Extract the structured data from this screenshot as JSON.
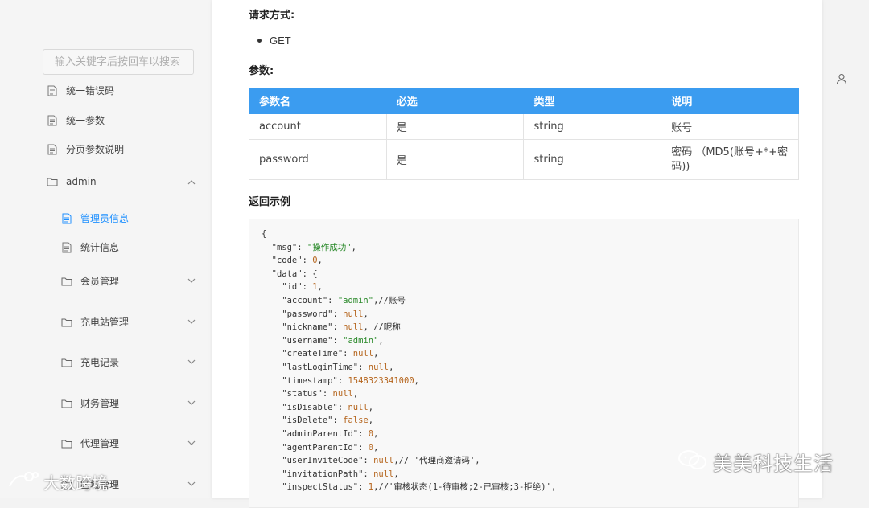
{
  "search": {
    "placeholder": "输入关键字后按回车以搜索"
  },
  "sidebar": {
    "items": [
      {
        "label": "统一错误码",
        "icon": "doc-icon"
      },
      {
        "label": "统一参数",
        "icon": "doc-icon"
      },
      {
        "label": "分页参数说明",
        "icon": "doc-icon"
      },
      {
        "label": "admin",
        "icon": "folder-icon"
      },
      {
        "label": "管理员信息",
        "icon": "doc-icon"
      },
      {
        "label": "统计信息",
        "icon": "doc-icon"
      },
      {
        "label": "会员管理",
        "icon": "folder-icon"
      },
      {
        "label": "充电站管理",
        "icon": "folder-icon"
      },
      {
        "label": "充电记录",
        "icon": "folder-icon"
      },
      {
        "label": "财务管理",
        "icon": "folder-icon"
      },
      {
        "label": "代理管理",
        "icon": "folder-icon"
      },
      {
        "label": "区域管理",
        "icon": "folder-icon"
      }
    ],
    "active_color": "#1e90ff"
  },
  "main": {
    "request_method_heading": "请求方式:",
    "request_method_value": "GET",
    "params_heading": "参数:",
    "table": {
      "headers": [
        "参数名",
        "必选",
        "类型",
        "说明"
      ],
      "rows": [
        [
          "account",
          "是",
          "string",
          "账号"
        ],
        [
          "password",
          "是",
          "string",
          "密码 （MD5(账号+*+密码))"
        ]
      ],
      "header_color": "#3b9cf0"
    },
    "return_heading": "返回示例",
    "code": {
      "open": "{",
      "l1k": "  \"msg\": ",
      "l1v": "\"操作成功\"",
      "l1e": ",",
      "l2k": "  \"code\": ",
      "l2v": "0",
      "l2e": ",",
      "l3": "  \"data\": {",
      "l4k": "    \"id\": ",
      "l4v": "1",
      "l4e": ",",
      "l5k": "    \"account\": ",
      "l5v": "\"admin\"",
      "l5e": ",//账号",
      "l6k": "    \"password\": ",
      "l6v": "null",
      "l6e": ",",
      "l7k": "    \"nickname\": ",
      "l7v": "null",
      "l7e": ", //昵称",
      "l8k": "    \"username\": ",
      "l8v": "\"admin\"",
      "l8e": ",",
      "l9k": "    \"createTime\": ",
      "l9v": "null",
      "l9e": ",",
      "l10k": "    \"lastLoginTime\": ",
      "l10v": "null",
      "l10e": ",",
      "l11k": "    \"timestamp\": ",
      "l11v": "1548323341000",
      "l11e": ",",
      "l12k": "    \"status\": ",
      "l12v": "null",
      "l12e": ",",
      "l13k": "    \"isDisable\": ",
      "l13v": "null",
      "l13e": ",",
      "l14k": "    \"isDelete\": ",
      "l14v": "false",
      "l14e": ",",
      "l15k": "    \"adminParentId\": ",
      "l15v": "0",
      "l15e": ",",
      "l16k": "    \"agentParentId\": ",
      "l16v": "0",
      "l16e": ",",
      "l17k": "    \"userInviteCode\": ",
      "l17v": "null",
      "l17e": ",// '代理商邀请码',",
      "l18k": "    \"invitationPath\": ",
      "l18v": "null",
      "l18e": ",",
      "l19k": "    \"inspectStatus\": ",
      "l19v": "1",
      "l19e": ",//'审核状态(1-待审核;2-已审核;3-拒绝)',"
    }
  },
  "watermarks": {
    "right": "美美科技生活",
    "left": "大数跨境"
  }
}
